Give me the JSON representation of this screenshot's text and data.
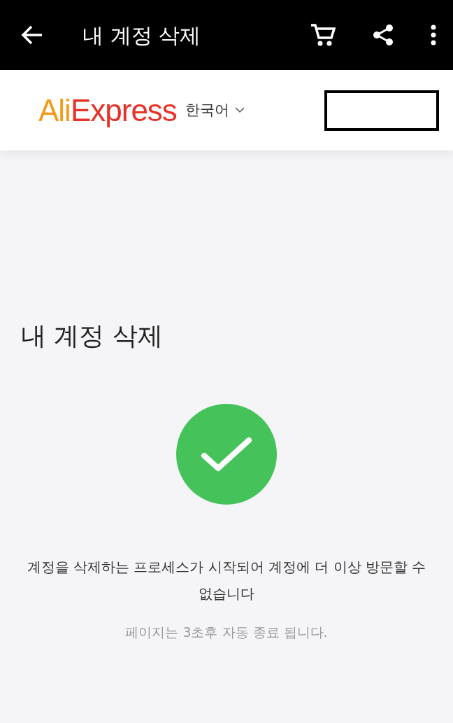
{
  "app_bar": {
    "title": "내 계정 삭제"
  },
  "header": {
    "logo": {
      "first": "Ali",
      "second": "Express"
    },
    "language": "한국어"
  },
  "content": {
    "heading": "내 계정 삭제",
    "message": "계정을 삭제하는 프로세스가 시작되어 계정에 더 이상 방문할 수 없습니다",
    "note": "페이지는 3초후 자동 종료 됩니다."
  }
}
